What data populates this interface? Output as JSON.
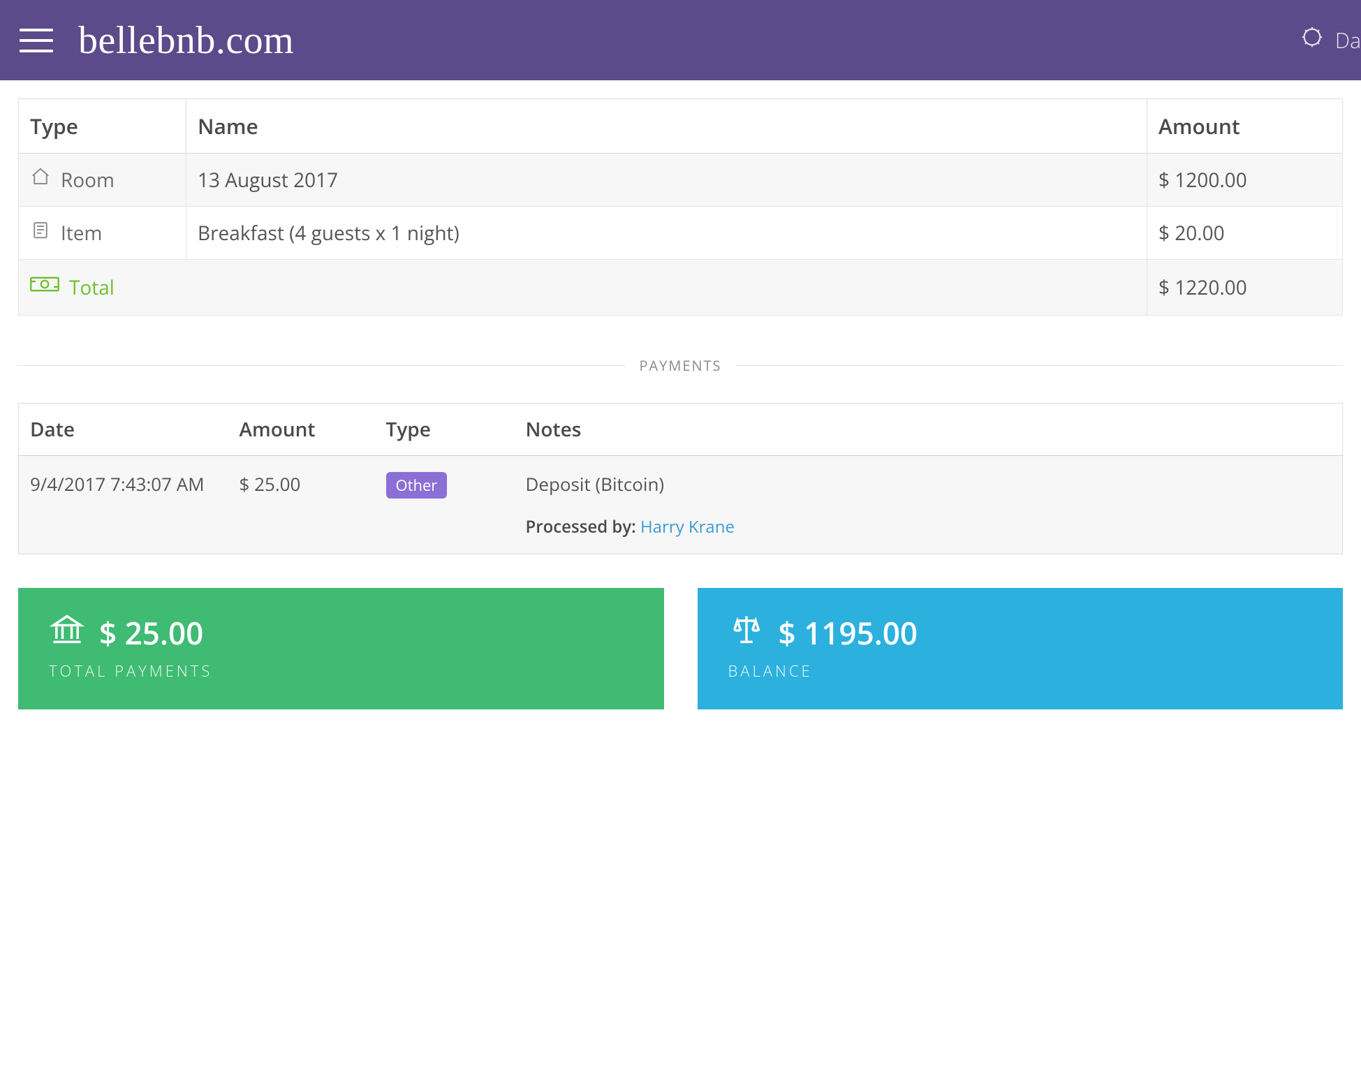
{
  "header": {
    "logo": "bellebnb.com",
    "right_partial": "Da"
  },
  "charges": {
    "headers": {
      "type": "Type",
      "name": "Name",
      "amount": "Amount"
    },
    "rows": [
      {
        "type_label": "Room",
        "name": "13 August 2017",
        "amount": "$ 1200.00"
      },
      {
        "type_label": "Item",
        "name": "Breakfast (4 guests x 1 night)",
        "amount": "$ 20.00"
      }
    ],
    "total": {
      "label": "Total",
      "amount": "$ 1220.00"
    }
  },
  "payments_section_title": "PAYMENTS",
  "payments": {
    "headers": {
      "date": "Date",
      "amount": "Amount",
      "type": "Type",
      "notes": "Notes"
    },
    "rows": [
      {
        "date": "9/4/2017 7:43:07 AM",
        "amount": "$ 25.00",
        "type_badge": "Other",
        "notes": "Deposit (Bitcoin)",
        "processed_label": "Processed by:",
        "processed_by": "Harry Krane"
      }
    ]
  },
  "summary": {
    "total_payments": {
      "amount": "$ 25.00",
      "label": "TOTAL PAYMENTS"
    },
    "balance": {
      "amount": "$ 1195.00",
      "label": "BALANCE"
    }
  }
}
